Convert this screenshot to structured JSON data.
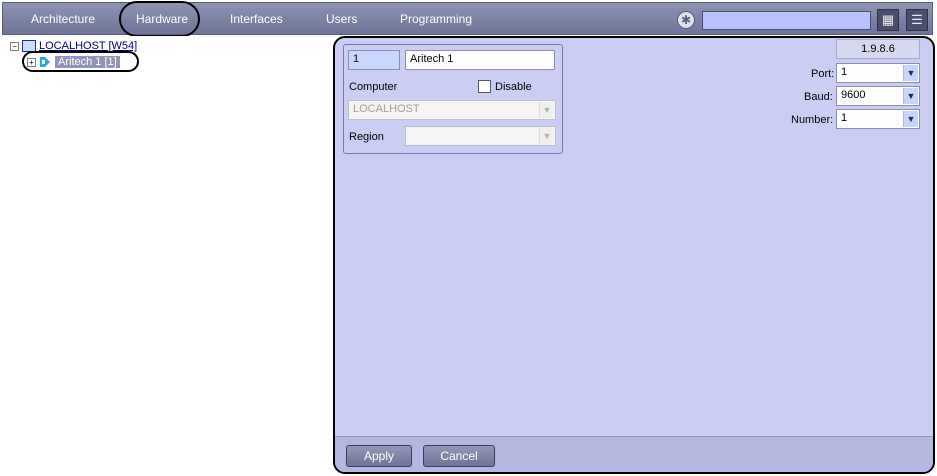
{
  "topbar": {
    "tabs": [
      "Architecture",
      "Hardware",
      "Interfaces",
      "Users",
      "Programming"
    ],
    "selected_tab": "Hardware",
    "icons": [
      "gear-icon",
      "layout-icon",
      "menu-icon"
    ]
  },
  "tree": {
    "root_label": "LOCALHOST [W54]",
    "child_label": "Aritech 1 [1]",
    "expander_collapse": "−",
    "expander_expand": "+"
  },
  "panel": {
    "version": "1.9.8.6",
    "id_value": "1",
    "name_value": "Aritech 1",
    "computer_label": "Computer",
    "disable_label": "Disable",
    "computer_value": "LOCALHOST",
    "region_label": "Region",
    "region_value": "",
    "port_label": "Port:",
    "port_value": "1",
    "baud_label": "Baud:",
    "baud_value": "9600",
    "number_label": "Number:",
    "number_value": "1",
    "apply_label": "Apply",
    "cancel_label": "Cancel"
  },
  "colors": {
    "panel_bg": "#cbcdf5",
    "topbar_bg": "#7e83a6",
    "accent_selection": "#9094b6"
  }
}
